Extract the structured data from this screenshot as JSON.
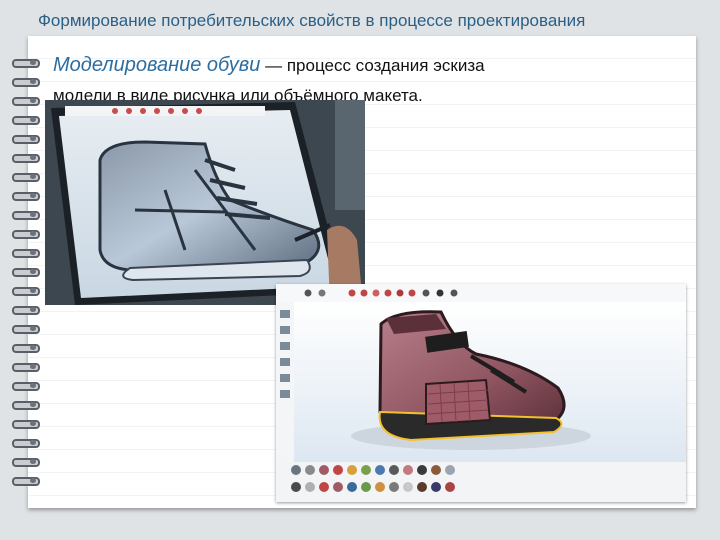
{
  "header": {
    "title": "Формирование потребительских свойств в процессе проектирования"
  },
  "intro": {
    "term": "Моделирование обуви",
    "dash": " — ",
    "definition_line1": "процесс создания эскиза",
    "definition_line2": "модели в виде рисунка или объёмного макета."
  },
  "images": [
    {
      "name": "tablet-sketch-photo",
      "icon": "sneaker-sketch-image"
    },
    {
      "name": "cad-3d-model-screenshot",
      "icon": "boot-3d-render-image"
    }
  ],
  "colors": {
    "title": "#2a5f86",
    "term": "#2c6da0",
    "background": "#dfe3e6",
    "paper": "#ffffff"
  }
}
